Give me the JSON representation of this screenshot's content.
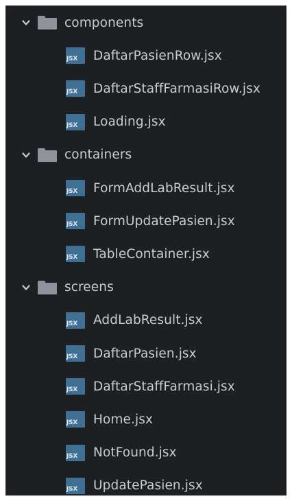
{
  "tree": [
    {
      "kind": "folder",
      "name": "components",
      "expanded": true,
      "children": [
        "DaftarPasienRow.jsx",
        "DaftarStaffFarmasiRow.jsx",
        "Loading.jsx"
      ]
    },
    {
      "kind": "folder",
      "name": "containers",
      "expanded": true,
      "children": [
        "FormAddLabResult.jsx",
        "FormUpdatePasien.jsx",
        "TableContainer.jsx"
      ]
    },
    {
      "kind": "folder",
      "name": "screens",
      "expanded": true,
      "children": [
        "AddLabResult.jsx",
        "DaftarPasien.jsx",
        "DaftarStaffFarmasi.jsx",
        "Home.jsx",
        "NotFound.jsx",
        "UpdatePasien.jsx"
      ]
    }
  ],
  "icons": {
    "folder": "folder-icon",
    "file": "jsx-file-icon",
    "file_badge": "JSX",
    "expand": "chevron-down-icon"
  },
  "colors": {
    "background": "#1e1f22",
    "text": "#c9ccd1",
    "folder": "#8f949c",
    "jsx_badge": "#3f6f93"
  }
}
